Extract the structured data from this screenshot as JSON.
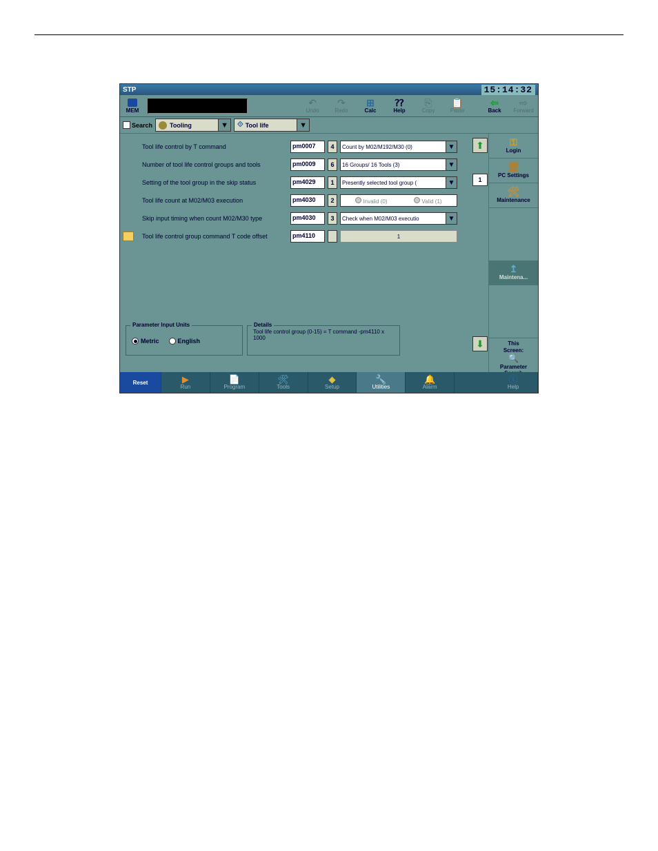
{
  "titlebar": {
    "mode": "STP",
    "clock": "15:14:32"
  },
  "toolbar": {
    "mem": "MEM",
    "undo": "Undo",
    "redo": "Redo",
    "calc": "Calc",
    "help": "Help",
    "copy": "Copy",
    "paste": "Paste",
    "back": "Back",
    "forward": "Forward"
  },
  "search": {
    "label": "Search",
    "dd1": "Tooling",
    "dd2": "Tool life"
  },
  "params": [
    {
      "label": "Tool life control by T command",
      "code": "pm0007",
      "idx": "4",
      "val": "Count by M02/M192/M30 (0)",
      "type": "dd"
    },
    {
      "label": "Number of tool life control groups and tools",
      "code": "pm0009",
      "idx": "6",
      "val": "16 Groups/ 16 Tools (3)",
      "type": "dd"
    },
    {
      "label": "Setting of the tool group in the skip status",
      "code": "pm4029",
      "idx": "1",
      "val": "Presently selected tool group (",
      "type": "dd"
    },
    {
      "label": "Tool life count at M02/M03 execution",
      "code": "pm4030",
      "idx": "2",
      "val": "",
      "type": "radio",
      "opt1": "Invalid (0)",
      "opt2": "Valid (1)"
    },
    {
      "label": "Skip input timing when count M02/M30 type",
      "code": "pm4030",
      "idx": "3",
      "val": "Check when M02/M03 executio",
      "type": "dd"
    },
    {
      "label": "Tool life control group command T code offset",
      "code": "pm4110",
      "idx": "",
      "val": "1",
      "type": "num",
      "note": true
    }
  ],
  "nav": {
    "page": "1"
  },
  "sidebar": {
    "login": "Login",
    "pcsettings": "PC Settings",
    "maintenance": "Maintenance",
    "tab": "Maintena...",
    "this1": "This",
    "this2": "Screen:",
    "this3": "Parameter",
    "this4": "Search"
  },
  "footer": {
    "units_legend": "Parameter Input Units",
    "metric": "Metric",
    "english": "English",
    "details_legend": "Details",
    "details_text": "Tool life control group (0-15) = T command -pm4110 x 1000"
  },
  "bottombar": {
    "reset": "Reset",
    "run": "Run",
    "program": "Program",
    "tools": "Tools",
    "setup": "Setup",
    "utilities": "Utilities",
    "alarm": "Alarm",
    "help": "Help"
  }
}
